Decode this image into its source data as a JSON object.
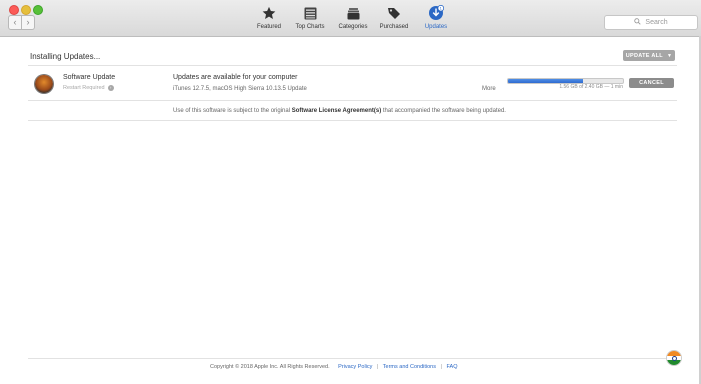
{
  "toolbar": {
    "tabs": [
      {
        "label": "Featured",
        "icon": "star-icon"
      },
      {
        "label": "Top Charts",
        "icon": "list-icon"
      },
      {
        "label": "Categories",
        "icon": "stack-icon"
      },
      {
        "label": "Purchased",
        "icon": "tag-icon"
      },
      {
        "label": "Updates",
        "icon": "updates-icon",
        "badge": "1"
      }
    ],
    "active_tab": "Updates",
    "search_placeholder": "Search",
    "back_glyph": "‹",
    "forward_glyph": "›"
  },
  "main": {
    "section_title": "Installing Updates...",
    "update_all_label": "UPDATE ALL",
    "item": {
      "name": "Software Update",
      "restart_note": "Restart Required",
      "title": "Updates are available for your computer",
      "detail": "iTunes 12.7.5, macOS High Sierra 10.13.5 Update",
      "more_label": "More",
      "progress_fraction": 0.65,
      "progress_text": "1.56 GB of 2.40 GB — 1 min",
      "cancel_label": "CANCEL"
    },
    "license": {
      "prefix": "Use of this software is subject to the original",
      "link": "Software License Agreement(s)",
      "suffix": "that accompanied the software being updated."
    }
  },
  "footer": {
    "copyright": "Copyright © 2018 Apple Inc. All Rights Reserved.",
    "links": [
      "Privacy Policy",
      "Terms and Conditions",
      "FAQ"
    ],
    "separator": "|"
  },
  "colors": {
    "accent": "#2b68c5",
    "progress": "#3d7de0",
    "cancel_bg": "#8c8c8c",
    "update_all_bg": "#a6a6a6"
  }
}
